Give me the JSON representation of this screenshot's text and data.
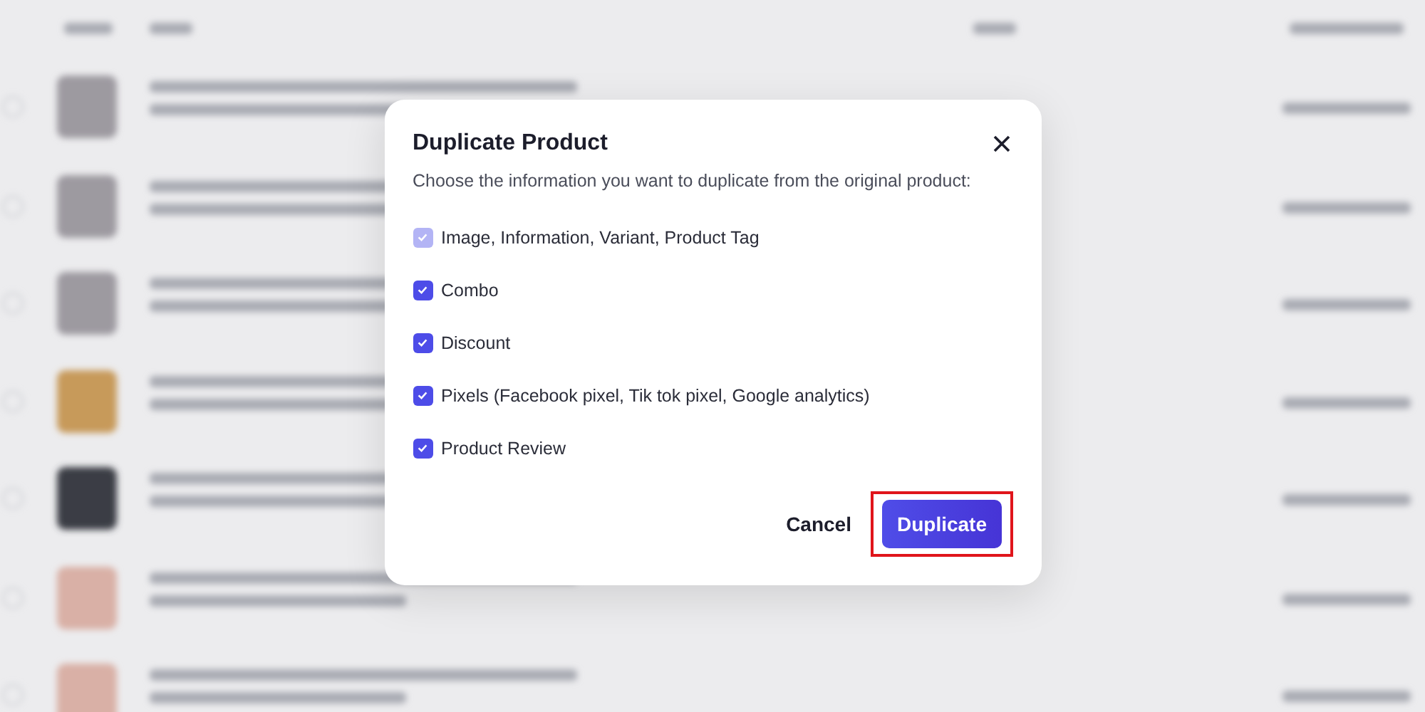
{
  "dialog": {
    "title": "Duplicate Product",
    "description": "Choose the information you want to duplicate from the original product:",
    "options": [
      {
        "label": "Image, Information, Variant, Product Tag",
        "checked": true,
        "disabled": true
      },
      {
        "label": "Combo",
        "checked": true,
        "disabled": false
      },
      {
        "label": "Discount",
        "checked": true,
        "disabled": false
      },
      {
        "label": "Pixels (Facebook pixel, Tik tok pixel, Google analytics)",
        "checked": true,
        "disabled": false
      },
      {
        "label": "Product Review",
        "checked": true,
        "disabled": false
      }
    ],
    "buttons": [
      {
        "label": "Cancel",
        "kind": "text",
        "highlighted": false
      },
      {
        "label": "Duplicate",
        "kind": "primary",
        "highlighted": true
      }
    ]
  }
}
